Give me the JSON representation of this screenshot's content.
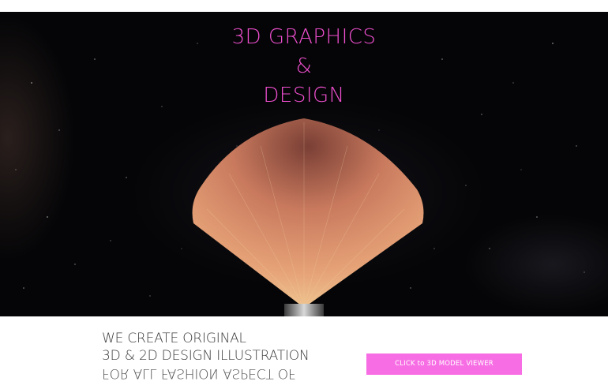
{
  "hero": {
    "title_lines": [
      "3D GRAPHICS",
      "&",
      "DESIGN"
    ],
    "image_subject": "makeup-fan-brush",
    "colors": {
      "title": "#ef4fcf",
      "background": "#050507",
      "bristle": "#d88a60"
    }
  },
  "tagline": {
    "lines": [
      "WE CREATE ORIGINAL",
      "3D & 2D DESIGN ILLUSTRATION",
      "FOR ALL FASHION ASPECT OF"
    ]
  },
  "cta": {
    "label": "CLICK to 3D MODEL VIEWER",
    "color": "#f76ee4"
  }
}
